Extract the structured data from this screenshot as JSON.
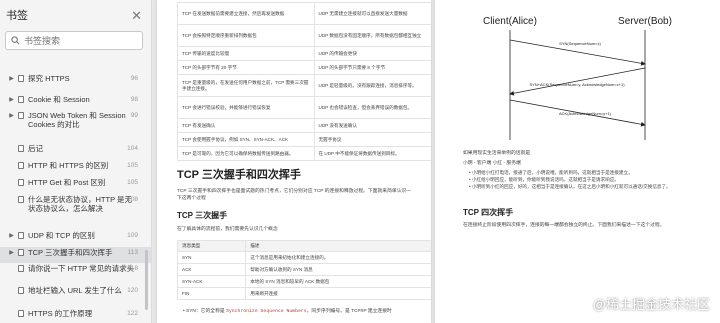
{
  "sidebar": {
    "title": "书签",
    "search_placeholder": "书签搜索",
    "items": [
      {
        "label": "探究 HTTPS",
        "page": "96",
        "caret": true
      },
      {
        "label": "Cookie 和 Session",
        "page": "98",
        "caret": true
      },
      {
        "label": "JSON Web Token 和 Session Cookies 的对比",
        "page": "99",
        "caret": true
      },
      {
        "label": "后记",
        "page": "104",
        "caret": false
      },
      {
        "label": "HTTP 和 HTTPS 的区别",
        "page": "105",
        "caret": false
      },
      {
        "label": "HTTP Get 和 Post 区别",
        "page": "105",
        "caret": false
      },
      {
        "label": "什么是无状态协议，HTTP 是无状态协议么，怎么解决",
        "page": "108",
        "caret": false
      },
      {
        "label": "UDP 和 TCP 的区别",
        "page": "109",
        "caret": true
      },
      {
        "label": "TCP 三次握手和四次挥手",
        "page": "113",
        "caret": true,
        "active": true
      },
      {
        "label": "请你说一下 HTTP 常见的请求头",
        "page": "118",
        "caret": false
      },
      {
        "label": "地址栏输入 URL 发生了什么",
        "page": "120",
        "caret": false
      },
      {
        "label": "HTTPS 的工作原理",
        "page": "122",
        "caret": false
      }
    ]
  },
  "left_page": {
    "top_table": [
      [
        "TCP 在发送数据前需要建立连接，然后再发送数据",
        "UDP 无需建立连接就可以直接发送大量数据"
      ],
      [
        "TCP 会按照特定顺序重新排列数据包",
        "UDP 数据包没有固定顺序，所有数据包都相互独立"
      ],
      [
        "TCP 传输的速度比较慢",
        "UDP 的传输会更快"
      ],
      [
        "TCP 的头部字节有 20 字节",
        "UDP 的头部字节只需要 8 个字节"
      ],
      [
        "TCP 是重量级的，在发送任何用户数据之前，TCP 需要三次握手建立连接。",
        "UDP 是轻量级的。没有跟踪连接，消息排序等。"
      ],
      [
        "TCP 会进行错误校验，并能够进行错误恢复",
        "UDP 也会错误检查，但会丢弃错误的数据包。"
      ],
      [
        "TCP 有发送确认",
        "UDP 没有发送确认"
      ],
      [
        "TCP 会使用握手协议，例如 SYN、SYN-ACK、ACK",
        "无握手协议"
      ],
      [
        "TCP 是可靠的，因为它可以确保将数据传送到路由器。",
        "在 UDP 中不能保证将数据传送到目标。"
      ]
    ],
    "section_title": "TCP 三次握手和四次挥手",
    "intro": "TCP 三次握手和四次挥手也是面试题的热门考点，它们分别对应 TCP 的连接和释放过程。下面就来简单认识一下这两个过程",
    "subsection_title": "TCP 三次握手",
    "subsection_intro": "在了解具体的流程前，我们需要先认识几个概念",
    "concept_table": {
      "headers": [
        "消息类型",
        "描述"
      ],
      "rows": [
        [
          "SYN",
          "这个消息是用来初始化和建立连接的。"
        ],
        [
          "ACK",
          "帮助对方确认收到的 SYN 消息"
        ],
        [
          "SYN-ACK",
          "本地的 SYN 消息和较早的 ACK 数据包"
        ],
        [
          "FIN",
          "用来断开连接"
        ]
      ]
    },
    "bullet_prefix": "SYN：它的全称是",
    "bullet_code": "Synchronize Sequence Numbers",
    "bullet_suffix": "，同步序列编号。是 TCP/IP 建立连接时"
  },
  "right_page": {
    "client_label": "Client(Alice)",
    "server_label": "Server(Bob)",
    "msg1": "SYN(SequenceNum=x)",
    "msg2": "SYN+ACK(SequenceNum=y, AcknowledgeNum=x+1)",
    "msg3": "ACK(AcknowledgeNum=y+1)",
    "para1": "如果用现实生活来举例的话就是",
    "para2": "小明 - 客户端  小红 - 服务端",
    "list": [
      "小明给小红打电话，接通了后，小明说喂，能听到吗，这就相当于是连接建立。",
      "小红给小明回应，能听到，你能听到我说话吗，这就相当于是请求响应。",
      "小明听到小红的回应，好的，这相当于是连接确认。在这之后小明和小红就可以通话/交换信息了。"
    ],
    "section_title": "TCP 四次挥手",
    "para3": "在连接终止阶段使用四次挥手，连接的每一端都会独立的终止。下面我们来描述一下这个过程。"
  },
  "watermark": "@稀土掘金技术社区",
  "colors": {
    "accent": "#1a3fb5",
    "code": "#c0392b"
  }
}
